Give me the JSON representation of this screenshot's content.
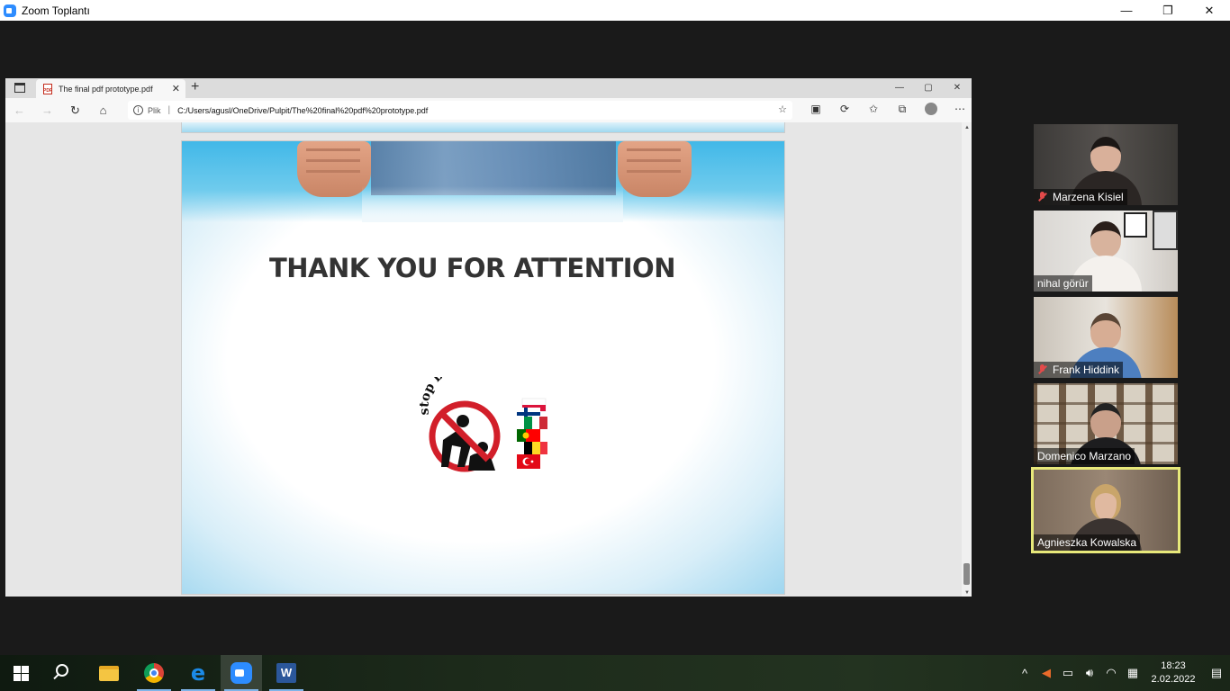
{
  "zoom_window": {
    "title": "Zoom Toplantı",
    "controls": [
      "—",
      "❐",
      "✕"
    ]
  },
  "browser": {
    "tab_title": "The final pdf prototype.pdf",
    "address_label": "Plik",
    "address_separator": "|",
    "url": "C:/Users/agusl/OneDrive/Pulpit/The%20final%20pdf%20prototype.pdf",
    "window_controls": [
      "—",
      "▢",
      "✕"
    ]
  },
  "slide": {
    "title": "THANK YOU FOR ATTENTION",
    "logo_text": "stop bullying"
  },
  "participants": [
    {
      "name": "Marzena Kisiel",
      "muted": true,
      "active": false
    },
    {
      "name": "nihal görür",
      "muted": false,
      "active": false
    },
    {
      "name": "Frank Hiddink",
      "muted": true,
      "active": false
    },
    {
      "name": "Domenico Marzano",
      "muted": false,
      "active": false
    },
    {
      "name": "Agnieszka Kowalska",
      "muted": false,
      "active": true
    }
  ],
  "taskbar": {
    "time": "18:23",
    "date": "2.02.2022",
    "apps": [
      "start-icon",
      "search-icon",
      "file-explorer-icon",
      "chrome-icon",
      "edge-icon",
      "zoom-icon",
      "word-icon"
    ]
  },
  "colors": {
    "zoom_blue": "#2d8cff",
    "active_speaker": "#e7e87a",
    "muted_red": "#e34a4a",
    "slide_blue": "#41b8e8"
  }
}
